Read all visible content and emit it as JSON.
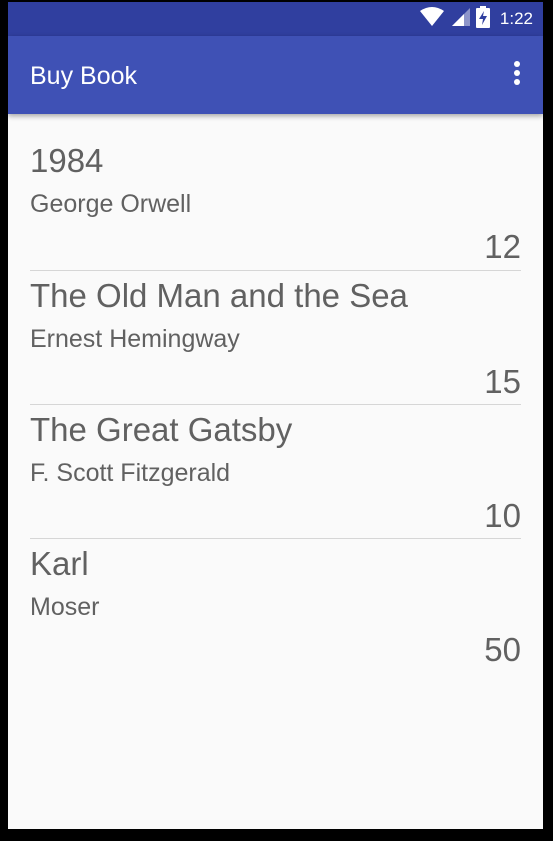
{
  "status_bar": {
    "time": "1:22",
    "icons": [
      "wifi-icon",
      "cellular-signal-icon",
      "battery-charging-icon"
    ],
    "color": "#303f9f"
  },
  "app_bar": {
    "title": "Buy Book",
    "color": "#3f51b5",
    "menu_icon": "more-vert-icon"
  },
  "books": [
    {
      "title": "1984",
      "author": "George Orwell",
      "price": "12"
    },
    {
      "title": "The Old Man and the Sea",
      "author": "Ernest Hemingway",
      "price": "15"
    },
    {
      "title": "The Great Gatsby",
      "author": "F. Scott Fitzgerald",
      "price": "10"
    },
    {
      "title": "Karl",
      "author": "Moser",
      "price": "50"
    }
  ]
}
